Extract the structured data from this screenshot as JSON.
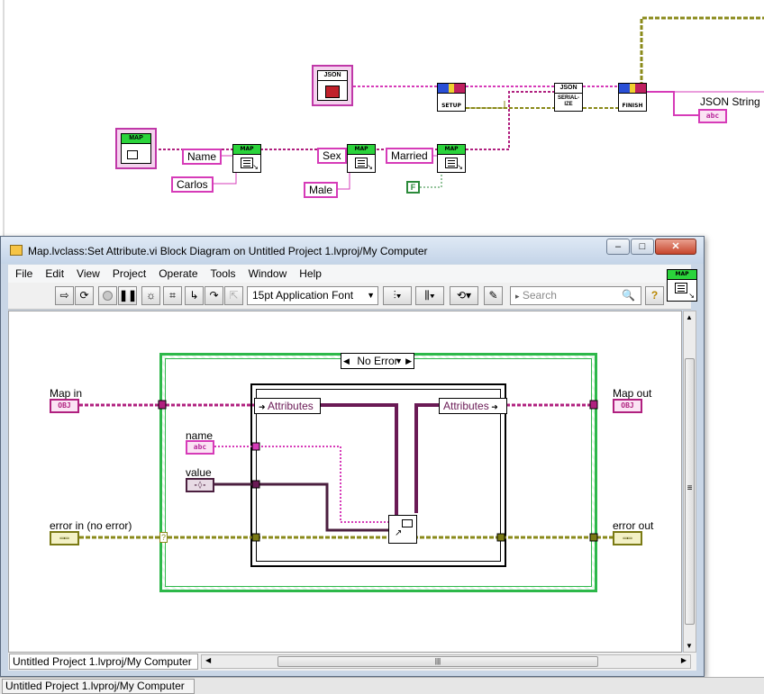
{
  "background_diagram": {
    "json_constant_label": "JSON",
    "map_constant_label": "MAP",
    "setup_label": "SETUP",
    "serialize_label": "SERIAL-\nIZE",
    "finish_label": "FINISH",
    "json_header": "JSON",
    "json_string_label": "JSON String",
    "json_string_terminal": "abc",
    "set_attr_header": "MAP",
    "name_const": "Name",
    "carlos_const": "Carlos",
    "sex_const": "Sex",
    "male_const": "Male",
    "married_const": "Married",
    "false_const": "F"
  },
  "window": {
    "title": "Map.lvclass:Set Attribute.vi Block Diagram on Untitled Project 1.lvproj/My Computer",
    "minimize": "–",
    "maximize": "□",
    "close": "✕",
    "menu": [
      "File",
      "Edit",
      "View",
      "Project",
      "Operate",
      "Tools",
      "Window",
      "Help"
    ],
    "font_select": "15pt Application Font",
    "search_placeholder": "Search",
    "help_label": "?",
    "vi_icon_header": "MAP",
    "status_path": "Untitled Project 1.lvproj/My Computer",
    "scroll_grip": "|||",
    "vscroll_grip": "≡"
  },
  "diagram": {
    "case_selector": "No Error",
    "map_in_label": "Map in",
    "map_in_term": "OBJ",
    "map_out_label": "Map out",
    "map_out_term": "OBJ",
    "name_label": "name",
    "name_term": "abc",
    "value_label": "value",
    "error_in_label": "error in (no error)",
    "error_out_label": "error out",
    "attributes_in": "Attributes",
    "attributes_out": "Attributes",
    "error_question": "?"
  },
  "taskbar": {
    "project_tab": "Untitled Project 1.lvproj/My Computer"
  },
  "colors": {
    "class_wire": "#b0207f",
    "string_wire": "#d63bb8",
    "error_wire": "#8a8a1a",
    "case_border": "#2db84a"
  }
}
